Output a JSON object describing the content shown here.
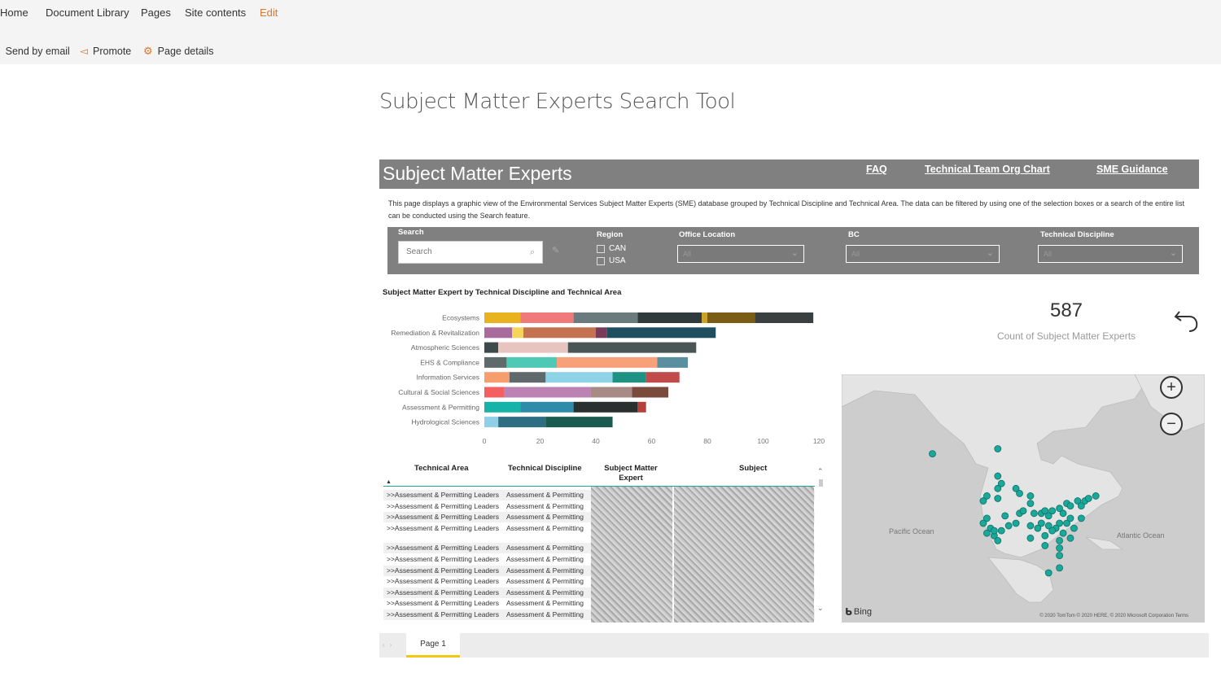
{
  "topnav": {
    "links": [
      "Home",
      "Document Library",
      "Pages",
      "Site contents"
    ],
    "edit": "Edit"
  },
  "commandbar": {
    "send": "Send by email",
    "promote": "Promote",
    "details": "Page details"
  },
  "page_title": "Subject Matter Experts Search Tool",
  "report": {
    "title": "Subject Matter Experts",
    "links": [
      "FAQ",
      "Technical Team Org Chart",
      "SME Guidance"
    ],
    "description": "This page displays a graphic view of the Environmental Services Subject Matter Experts (SME) database grouped by Technical Discipline and Technical Area. The data can be filtered by using one of the selection boxes or a search of the entire list can be conducted using the Search feature.",
    "filters": {
      "search_label": "Search",
      "search_placeholder": "Search",
      "region_label": "Region",
      "region_options": [
        "CAN",
        "USA"
      ],
      "office_label": "Office Location",
      "office_value": "All",
      "bc_label": "BC",
      "bc_value": "All",
      "discipline_label": "Technical Discipline",
      "discipline_value": "All"
    },
    "kpi": {
      "value": "587",
      "label": "Count of Subject Matter Experts"
    },
    "table": {
      "headers": [
        "Technical Area",
        "Technical Discipline",
        "Subject Matter Expert",
        "Subject"
      ],
      "rows": [
        ">>Assessment & Permitting Leaders",
        ">>Assessment & Permitting Leaders",
        ">>Assessment & Permitting Leaders",
        ">>Assessment & Permitting Leaders",
        ">>Assessment & Permitting Leaders",
        ">>Assessment & Permitting Leaders",
        ">>Assessment & Permitting Leaders",
        ">>Assessment & Permitting Leaders",
        ">>Assessment & Permitting Leaders",
        ">>Assessment & Permitting Leaders",
        ">>Assessment & Permitting Leaders"
      ],
      "discipline": "Assessment & Permitting"
    },
    "map": {
      "ocean_pacific": "Pacific Ocean",
      "ocean_atlantic": "Atlantic Ocean",
      "bing": "Bing",
      "credit": "© 2020 TomTom © 2020 HERE, © 2020 Microsoft Corporation Terms"
    },
    "pages": {
      "tab": "Page 1"
    }
  },
  "colors": {
    "header_gray": "#808080",
    "teal": "#19a89a",
    "accent_orange": "#e1742c",
    "tab_yellow": "#f2c811"
  },
  "chart_data": {
    "type": "bar",
    "orientation": "horizontal",
    "stacked": true,
    "title": "Subject Matter Expert by Technical Discipline and Technical Area",
    "categories": [
      "Ecosystems",
      "Remediation & Revitalization",
      "Atmospheric Sciences",
      "EHS & Compliance",
      "Information Services",
      "Cultural & Social Sciences",
      "Assessment & Permitting",
      "Hydrological Sciences"
    ],
    "segments": [
      [
        13,
        19,
        23,
        23,
        2,
        17,
        21
      ],
      [
        10,
        4,
        26,
        4,
        39
      ],
      [
        5,
        25,
        46
      ],
      [
        8,
        18,
        36,
        11
      ],
      [
        9,
        13,
        24,
        12,
        12
      ],
      [
        7,
        31,
        15,
        13
      ],
      [
        13,
        19,
        23,
        3
      ],
      [
        5,
        17,
        24
      ]
    ],
    "segment_colors": [
      [
        "#e9b21f",
        "#f07a7a",
        "#6b7a7c",
        "#2e3a3b",
        "#c9a227",
        "#7a5c16",
        "#3a3f40"
      ],
      [
        "#a86b9c",
        "#f5d55c",
        "#c47250",
        "#7a3b5a",
        "#1f4e5f"
      ],
      [
        "#3d4a4c",
        "#e8c4c0",
        "#4a5556"
      ],
      [
        "#5f6a6b",
        "#4ec9b5",
        "#f7a07a",
        "#5a8fa0"
      ],
      [
        "#f79e6e",
        "#606a6c",
        "#8fd3e8",
        "#1e9282",
        "#c14a4a"
      ],
      [
        "#f26060",
        "#bb82b3",
        "#a88a86",
        "#7a4a3a"
      ],
      [
        "#16b3a8",
        "#2f8ca8",
        "#2a2f30",
        "#b5413a"
      ],
      [
        "#8fd0e8",
        "#2f6e82",
        "#1b5a4e"
      ]
    ],
    "xlim": [
      0,
      120
    ],
    "xticks": [
      0,
      20,
      40,
      60,
      80,
      100,
      120
    ]
  },
  "map_points": [
    [
      0.25,
      0.32
    ],
    [
      0.43,
      0.3
    ],
    [
      0.43,
      0.41
    ],
    [
      0.44,
      0.44
    ],
    [
      0.43,
      0.46
    ],
    [
      0.48,
      0.46
    ],
    [
      0.49,
      0.48
    ],
    [
      0.4,
      0.49
    ],
    [
      0.39,
      0.51
    ],
    [
      0.43,
      0.5
    ],
    [
      0.52,
      0.49
    ],
    [
      0.52,
      0.52
    ],
    [
      0.53,
      0.56
    ],
    [
      0.55,
      0.56
    ],
    [
      0.56,
      0.55
    ],
    [
      0.57,
      0.57
    ],
    [
      0.58,
      0.55
    ],
    [
      0.6,
      0.54
    ],
    [
      0.61,
      0.56
    ],
    [
      0.62,
      0.52
    ],
    [
      0.63,
      0.53
    ],
    [
      0.65,
      0.51
    ],
    [
      0.66,
      0.53
    ],
    [
      0.67,
      0.51
    ],
    [
      0.7,
      0.49
    ],
    [
      0.68,
      0.5
    ],
    [
      0.6,
      0.6
    ],
    [
      0.59,
      0.62
    ],
    [
      0.62,
      0.6
    ],
    [
      0.63,
      0.58
    ],
    [
      0.57,
      0.61
    ],
    [
      0.55,
      0.6
    ],
    [
      0.54,
      0.62
    ],
    [
      0.52,
      0.61
    ],
    [
      0.4,
      0.58
    ],
    [
      0.39,
      0.6
    ],
    [
      0.41,
      0.62
    ],
    [
      0.42,
      0.65
    ],
    [
      0.43,
      0.67
    ],
    [
      0.44,
      0.63
    ],
    [
      0.46,
      0.61
    ],
    [
      0.48,
      0.6
    ],
    [
      0.49,
      0.56
    ],
    [
      0.5,
      0.55
    ],
    [
      0.4,
      0.64
    ],
    [
      0.42,
      0.63
    ],
    [
      0.45,
      0.57
    ],
    [
      0.56,
      0.65
    ],
    [
      0.58,
      0.63
    ],
    [
      0.6,
      0.67
    ],
    [
      0.61,
      0.64
    ],
    [
      0.6,
      0.7
    ],
    [
      0.52,
      0.66
    ],
    [
      0.56,
      0.69
    ],
    [
      0.63,
      0.66
    ],
    [
      0.64,
      0.62
    ],
    [
      0.66,
      0.58
    ],
    [
      0.6,
      0.73
    ],
    [
      0.6,
      0.78
    ],
    [
      0.57,
      0.8
    ]
  ]
}
